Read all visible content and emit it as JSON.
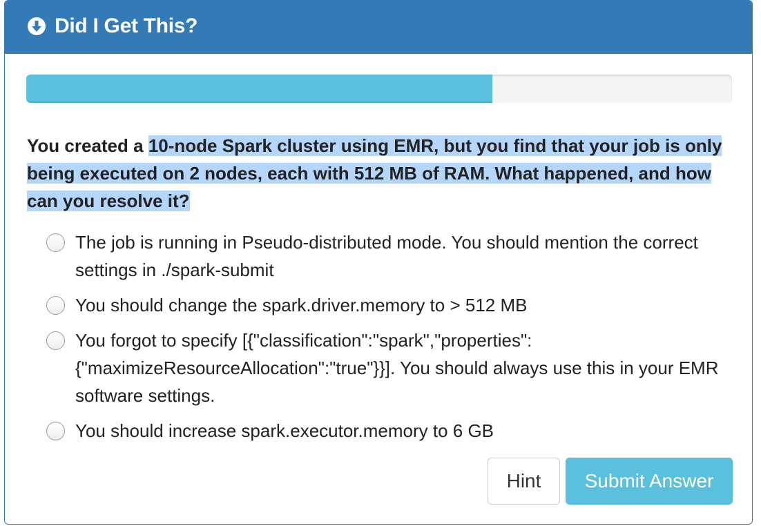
{
  "header": {
    "title": "Did I Get This?",
    "icon": "circle-arrow-down-icon"
  },
  "progress": {
    "percent": 66
  },
  "question": {
    "lead": "You created a ",
    "highlighted": "10-node Spark cluster using EMR, but you find that your job is only being executed on 2 nodes, each with 512 MB of RAM. What happened, and how can you resolve it?"
  },
  "options": [
    {
      "label": "The job is running in Pseudo-distributed mode. You should mention the correct settings in ./spark-submit"
    },
    {
      "label": "You should change the spark.driver.memory to > 512 MB"
    },
    {
      "label": "You forgot to specify [{\"classification\":\"spark\",\"properties\": {\"maximizeResourceAllocation\":\"true\"}}]. You should always use this in your EMR software settings."
    },
    {
      "label": "You should increase spark.executor.memory to 6 GB"
    }
  ],
  "buttons": {
    "hint": "Hint",
    "submit": "Submit Answer"
  },
  "colors": {
    "header_bg": "#337ab7",
    "progress_fill": "#5bc0de",
    "submit_bg": "#5bc0de",
    "highlight": "#b4d6fb"
  }
}
